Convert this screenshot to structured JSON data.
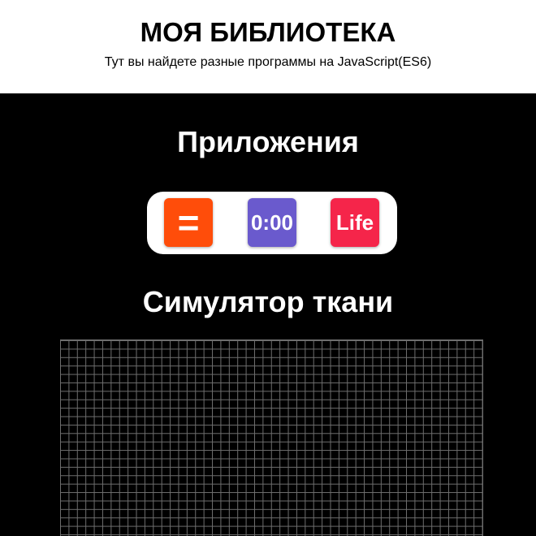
{
  "header": {
    "title": "МОЯ БИБЛИОТЕКА",
    "subtitle": "Тут вы найдете разные программы на JavaScript(ES6)"
  },
  "apps": {
    "title": "Приложения",
    "items": [
      {
        "label": "=",
        "color": "#ff4d0a",
        "name": "calculator"
      },
      {
        "label": "0:00",
        "color": "#6a5acd",
        "name": "timer"
      },
      {
        "label": "Life",
        "color": "#f5254a",
        "name": "game-of-life"
      }
    ]
  },
  "simulator": {
    "title": "Симулятор ткани"
  },
  "colors": {
    "header_bg": "#ffffff",
    "page_bg": "#000000",
    "grid_line": "#6e6e6e"
  }
}
